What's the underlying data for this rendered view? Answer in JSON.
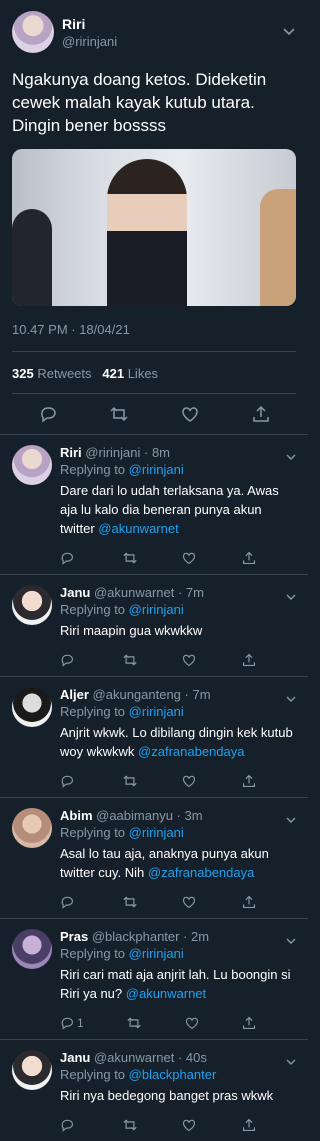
{
  "main": {
    "name": "Riri",
    "handle": "@ririnjani",
    "text": "Ngakunya doang ketos. Dideketin cewek malah kayak kutub utara. Dingin bener bossss",
    "timestamp": "10.47 PM · 18/04/21",
    "retweets_count": "325",
    "retweets_label": "Retweets",
    "likes_count": "421",
    "likes_label": "Likes"
  },
  "replying_label": "Replying to",
  "replies": [
    {
      "name": "Riri",
      "meta": "@ririnjani · 8m",
      "to": "@ririnjani",
      "text": "Dare dari lo udah terlaksana ya. Awas aja lu kalo dia beneran punya akun twitter",
      "mention": "@akunwarnet",
      "reply_count": ""
    },
    {
      "name": "Janu",
      "meta": "@akunwarnet · 7m",
      "to": "@ririnjani",
      "text": "Riri maapin gua wkwkkw",
      "mention": "",
      "reply_count": ""
    },
    {
      "name": "Aljer",
      "meta": "@akunganteng · 7m",
      "to": "@ririnjani",
      "text": "Anjrit wkwk. Lo dibilang dingin kek kutub woy wkwkwk",
      "mention": "@zafranabendaya",
      "reply_count": ""
    },
    {
      "name": "Abim",
      "meta": "@aabimanyu · 3m",
      "to": "@ririnjani",
      "text": "Asal lo tau aja, anaknya punya akun twitter cuy. Nih",
      "mention": "@zafranabendaya",
      "reply_count": ""
    },
    {
      "name": "Pras",
      "meta": "@blackphanter · 2m",
      "to": "@ririnjani",
      "text": "Riri cari mati aja anjrit lah. Lu boongin si Riri ya nu?",
      "mention": "@akunwarnet",
      "reply_count": "1"
    },
    {
      "name": "Janu",
      "meta": "@akunwarnet · 40s",
      "to": "@blackphanter",
      "text": "Riri nya bedegong banget pras wkwk",
      "mention": "",
      "reply_count": ""
    }
  ],
  "colors": {
    "bg": "#15202b",
    "link": "#1da1f2",
    "muted": "#8899a6",
    "divider": "#38444d"
  }
}
